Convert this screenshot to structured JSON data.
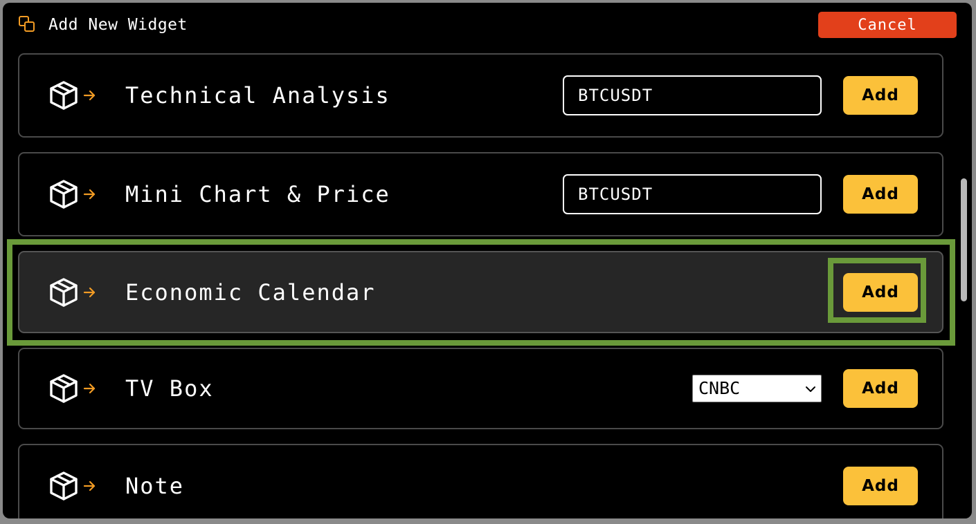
{
  "dialog": {
    "title": "Add New Widget",
    "title_icon": "copy-icon",
    "cancel_label": "Cancel"
  },
  "widgets": [
    {
      "name": "Technical Analysis",
      "icon": "package-icon",
      "arrow_icon": "arrow-right-icon",
      "symbol": "BTCUSDT",
      "add_label": "Add"
    },
    {
      "name": "Mini Chart & Price",
      "icon": "package-icon",
      "arrow_icon": "arrow-right-icon",
      "symbol": "BTCUSDT",
      "add_label": "Add"
    },
    {
      "name": "Economic Calendar",
      "icon": "package-icon",
      "arrow_icon": "arrow-right-icon",
      "add_label": "Add",
      "highlighted": true
    },
    {
      "name": "TV Box",
      "icon": "package-icon",
      "arrow_icon": "arrow-right-icon",
      "channel": "CNBC",
      "add_label": "Add"
    },
    {
      "name": "Note",
      "icon": "package-icon",
      "arrow_icon": "arrow-right-icon",
      "add_label": "Add"
    }
  ],
  "colors": {
    "accent": "#fbc13a",
    "cancel": "#e2401b",
    "highlight_outline": "#6a9a3a",
    "background": "#000000"
  }
}
